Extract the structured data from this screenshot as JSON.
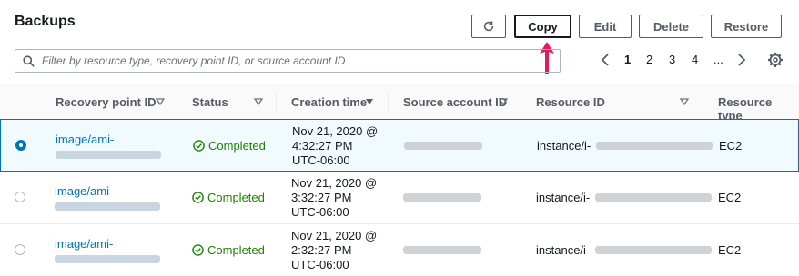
{
  "header": {
    "title": "Backups",
    "buttons": {
      "copy": "Copy",
      "edit": "Edit",
      "delete": "Delete",
      "restore": "Restore"
    }
  },
  "filter": {
    "placeholder": "Filter by resource type, recovery point ID, or source account ID",
    "value": ""
  },
  "pagination": {
    "pages": [
      "1",
      "2",
      "3",
      "4",
      "..."
    ],
    "current": "1"
  },
  "table": {
    "columns": [
      "Recovery point ID",
      "Status",
      "Creation time",
      "Source account ID",
      "Resource ID",
      "Resource type"
    ],
    "rows": [
      {
        "selected": true,
        "recovery_point_prefix": "image/ami-",
        "status": "Completed",
        "time_line1": "Nov 21, 2020 @",
        "time_line2": "4:32:27 PM",
        "time_line3": "UTC-06:00",
        "resource_id_prefix": "instance/i-",
        "resource_type": "EC2"
      },
      {
        "selected": false,
        "recovery_point_prefix": "image/ami-",
        "status": "Completed",
        "time_line1": "Nov 21, 2020 @",
        "time_line2": "3:32:27 PM",
        "time_line3": "UTC-06:00",
        "resource_id_prefix": "instance/i-",
        "resource_type": "EC2"
      },
      {
        "selected": false,
        "recovery_point_prefix": "image/ami-",
        "status": "Completed",
        "time_line1": "Nov 21, 2020 @",
        "time_line2": "2:32:27 PM",
        "time_line3": "UTC-06:00",
        "resource_id_prefix": "instance/i-",
        "resource_type": "EC2"
      }
    ]
  },
  "colors": {
    "accent": "#0073bb",
    "success": "#1d8102",
    "annotation_arrow": "#e8185f"
  },
  "icons": [
    "refresh-icon",
    "search-icon",
    "chevron-left-icon",
    "chevron-right-icon",
    "settings-gear-icon",
    "sort-caret-icon",
    "check-circle-icon",
    "up-arrow-annotation"
  ]
}
